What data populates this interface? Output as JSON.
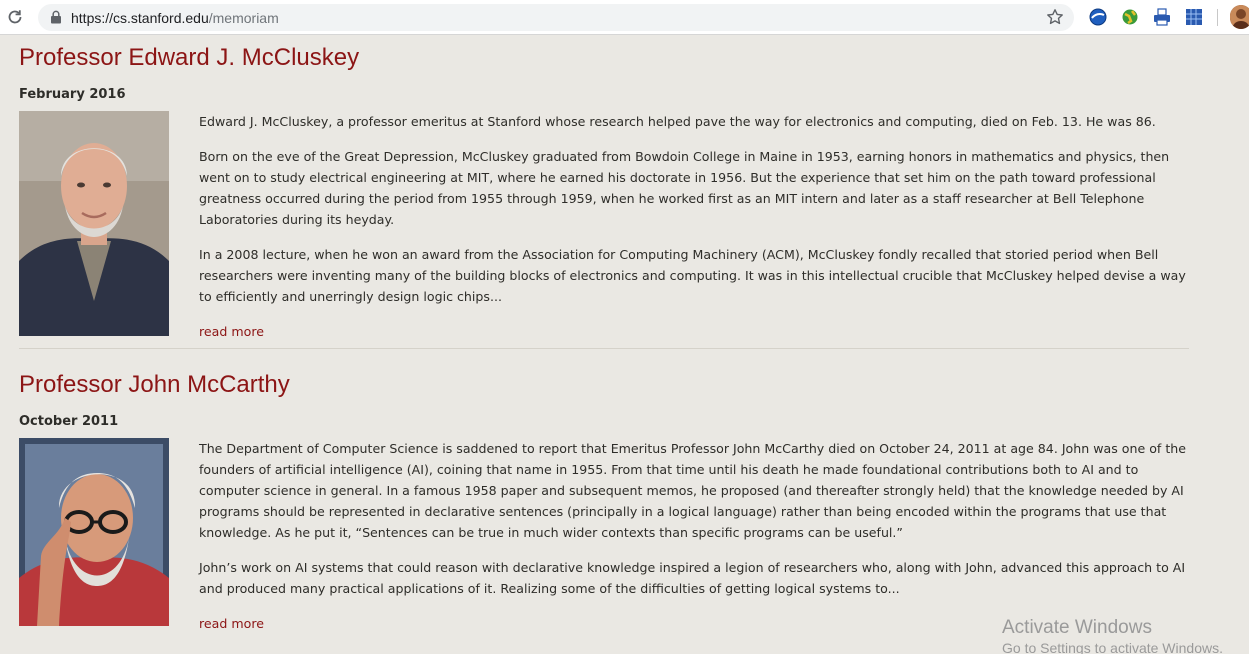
{
  "browser": {
    "url_host": "https://cs.stanford.edu",
    "url_path": "/memoriam",
    "extensions": [
      {
        "name": "globe-extension-icon",
        "color": "#1f5fbf"
      },
      {
        "name": "earth-extension-icon",
        "color": "#3a9a3a"
      },
      {
        "name": "printer-extension-icon",
        "color": "#2a5ab0"
      },
      {
        "name": "grid-extension-icon",
        "color": "#2a5ab0"
      }
    ]
  },
  "articles": [
    {
      "title": "Professor Edward J. McCluskey",
      "date": "February 2016",
      "paragraphs": [
        "Edward J. McCluskey, a professor emeritus at Stanford whose research helped pave the way for electronics and computing, died on Feb. 13. He was 86.",
        "Born on the eve of the Great Depression, McCluskey graduated from Bowdoin College in Maine in 1953, earning honors in mathematics and physics, then went on to study electrical engineering at MIT, where he earned his doctorate in 1956. But the experience that set him on the path toward professional greatness occurred during the period from 1955 through 1959, when he worked first as an MIT intern and later as a staff researcher at Bell Telephone Laboratories during its heyday.",
        "In a 2008 lecture, when he won an award from the Association for Computing Machinery (ACM), McCluskey fondly recalled that storied period when Bell researchers were inventing many of the building blocks of electronics and computing. It was in this intellectual crucible that McCluskey helped devise a way to efficiently and unerringly design logic chips..."
      ],
      "read_more": "read more"
    },
    {
      "title": "Professor John McCarthy",
      "date": "October 2011",
      "paragraphs": [
        "The Department of Computer Science is saddened to report that Emeritus Professor John McCarthy died on October 24, 2011 at age 84.  John was one of the founders of artificial intelligence (AI), coining that name in 1955.  From that time until his death he made foundational contributions both to AI and to computer science in general.  In a famous 1958 paper and subsequent memos, he proposed (and thereafter strongly held) that the knowledge needed by AI programs should be represented in declarative sentences (principally in a logical language) rather than being encoded within the programs that use that knowledge.  As he put it, “Sentences can be true in much wider contexts than specific programs can be useful.”",
        "John’s work on AI systems that could reason with declarative knowledge inspired a legion of researchers who, along with John, advanced this approach to AI and produced many practical applications of it.  Realizing some of the difficulties of getting logical systems to..."
      ],
      "read_more": "read more"
    }
  ],
  "watermark": {
    "line1": "Activate Windows",
    "line2": "Go to Settings to activate Windows."
  }
}
